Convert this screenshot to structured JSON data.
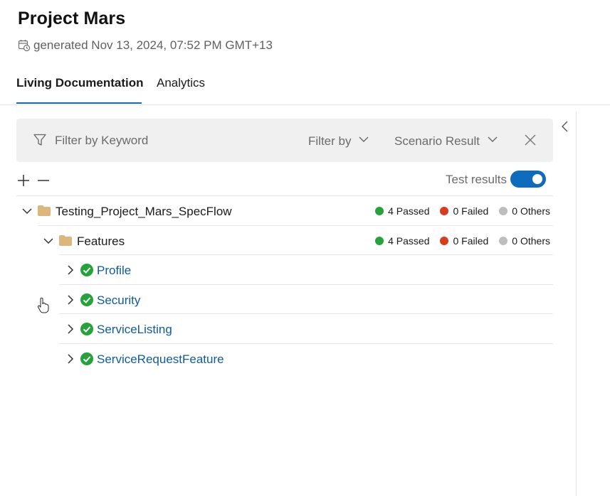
{
  "header": {
    "title": "Project Mars",
    "generated": "generated Nov 13, 2024, 07:52 PM GMT+13"
  },
  "tabs": [
    {
      "label": "Living Documentation",
      "active": true
    },
    {
      "label": "Analytics",
      "active": false
    }
  ],
  "filter": {
    "keyword_placeholder": "Filter by Keyword",
    "filter_by_label": "Filter by",
    "scenario_result_label": "Scenario Result"
  },
  "toolbar": {
    "test_results_label": "Test results",
    "test_results_on": true
  },
  "colors": {
    "accent": "#0f6cbd",
    "passed": "#23a33a",
    "failed": "#d83b1d",
    "others": "#bdbdbd",
    "folder": "#dcb67a",
    "link": "#0f5c9a"
  },
  "tree": {
    "root": {
      "label": "Testing_Project_Mars_SpecFlow",
      "passed": "4 Passed",
      "failed": "0 Failed",
      "others": "0 Others"
    },
    "features": {
      "label": "Features",
      "passed": "4 Passed",
      "failed": "0 Failed",
      "others": "0 Others"
    },
    "items": [
      {
        "label": "Profile"
      },
      {
        "label": "Security"
      },
      {
        "label": "ServiceListing"
      },
      {
        "label": "ServiceRequestFeature"
      }
    ]
  }
}
